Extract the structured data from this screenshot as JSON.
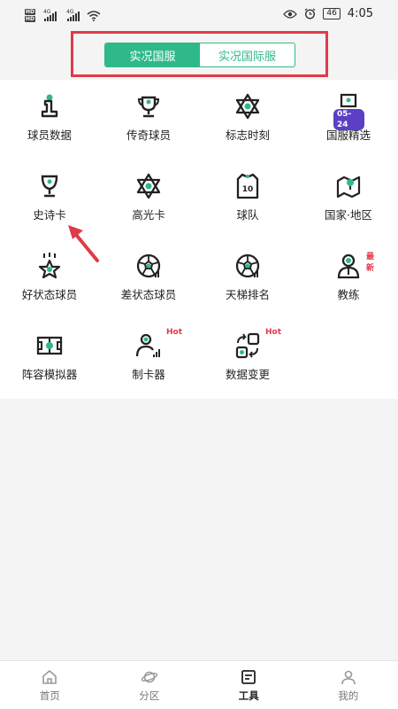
{
  "status_bar": {
    "hd1": "HD",
    "hd2": "HD",
    "net1": "4G",
    "net2": "4G",
    "battery": "46",
    "time": "4:05"
  },
  "segment": {
    "tabs": [
      {
        "label": "实况国服",
        "active": true
      },
      {
        "label": "实况国际服",
        "active": false
      }
    ],
    "accent": "#2fb98a",
    "highlight_border": "#e03a4a"
  },
  "tools": [
    {
      "label": "球员数据",
      "icon": "player-data-icon"
    },
    {
      "label": "传奇球员",
      "icon": "trophy-icon"
    },
    {
      "label": "标志时刻",
      "icon": "star-of-david-icon"
    },
    {
      "label": "国服精选",
      "icon": "featured-icon",
      "date_badge": "05-24"
    },
    {
      "label": "史诗卡",
      "icon": "cup-icon"
    },
    {
      "label": "高光卡",
      "icon": "star-outline-icon"
    },
    {
      "label": "球队",
      "icon": "jersey-icon",
      "number": "10"
    },
    {
      "label": "国家·地区",
      "icon": "map-icon"
    },
    {
      "label": "好状态球员",
      "icon": "good-form-icon"
    },
    {
      "label": "差状态球员",
      "icon": "football-icon"
    },
    {
      "label": "天梯排名",
      "icon": "ranking-football-icon"
    },
    {
      "label": "教练",
      "icon": "coach-icon",
      "badge": "最新"
    },
    {
      "label": "阵容模拟器",
      "icon": "formation-icon"
    },
    {
      "label": "制卡器",
      "icon": "card-maker-icon",
      "badge": "Hot"
    },
    {
      "label": "数据变更",
      "icon": "data-change-icon",
      "badge": "Hot"
    }
  ],
  "bottom_nav": [
    {
      "label": "首页",
      "icon": "home-icon",
      "active": false
    },
    {
      "label": "分区",
      "icon": "planet-icon",
      "active": false
    },
    {
      "label": "工具",
      "icon": "tools-icon",
      "active": true
    },
    {
      "label": "我的",
      "icon": "profile-icon",
      "active": false
    }
  ]
}
